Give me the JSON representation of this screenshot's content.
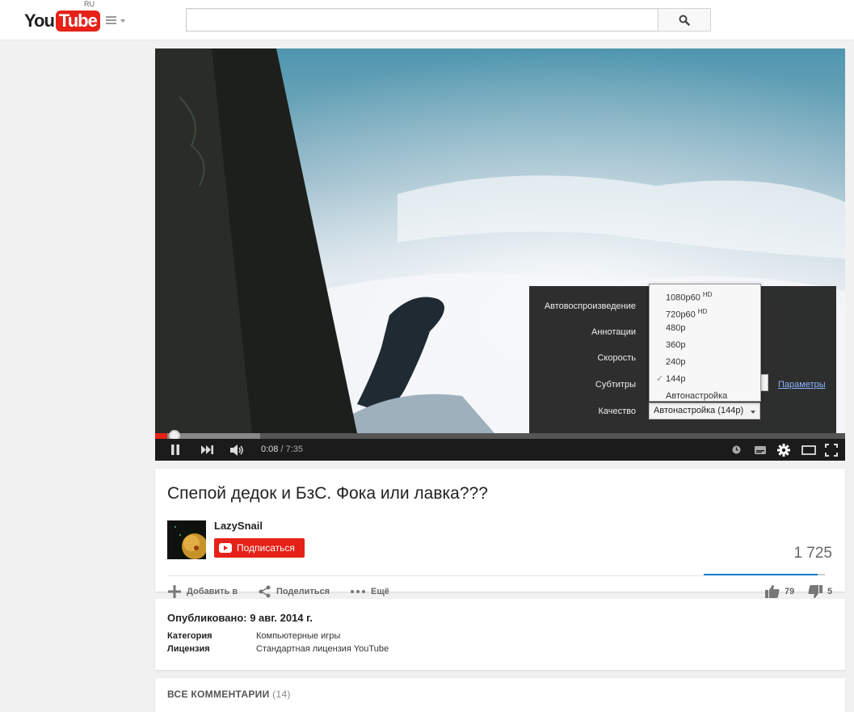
{
  "header": {
    "logo_you": "You",
    "logo_tube": "Tube",
    "country": "RU",
    "search_value": ""
  },
  "player": {
    "time_current": "0:08",
    "time_separator": " / ",
    "time_duration": "7:35",
    "progress_played_fraction": 0.018,
    "progress_buffered_fraction": 0.152,
    "settings": {
      "autoplay_label": "Автовоспроизведение",
      "annotations_label": "Аннотации",
      "speed_label": "Скорость",
      "subtitles_label": "Субтитры",
      "params_link": "Параметры",
      "quality_label": "Качество",
      "quality_value": "Автонастройка (144p)"
    },
    "quality_options": [
      {
        "label": "1080p60",
        "badge": "HD",
        "selected": false
      },
      {
        "label": "720p60",
        "badge": "HD",
        "selected": false
      },
      {
        "label": "480p",
        "badge": "",
        "selected": false
      },
      {
        "label": "360p",
        "badge": "",
        "selected": false
      },
      {
        "label": "240p",
        "badge": "",
        "selected": false
      },
      {
        "label": "144p",
        "badge": "",
        "selected": true
      },
      {
        "label": "Автонастройка",
        "badge": "",
        "selected": false
      }
    ],
    "check_mark": "✓",
    "accent_color": "#e62117"
  },
  "video_info": {
    "title": "Спепой дедок и БзС. Фока или лавка???",
    "channel": "LazySnail",
    "subscribe_label": "Подписаться",
    "views": "1 725",
    "like_fraction": 0.94,
    "actions": {
      "add_label": "Добавить в",
      "share_label": "Поделиться",
      "more_label": "Ещё"
    },
    "likes": "79",
    "dislikes": "5"
  },
  "description": {
    "published": "Опубликовано: 9 авг. 2014 г.",
    "category_key": "Категория",
    "category_value": "Компьютерные игры",
    "license_key": "Лицензия",
    "license_value": "Стандартная лицензия YouTube"
  },
  "comments": {
    "heading": "ВСЕ КОММЕНТАРИИ",
    "count": "(14)"
  }
}
